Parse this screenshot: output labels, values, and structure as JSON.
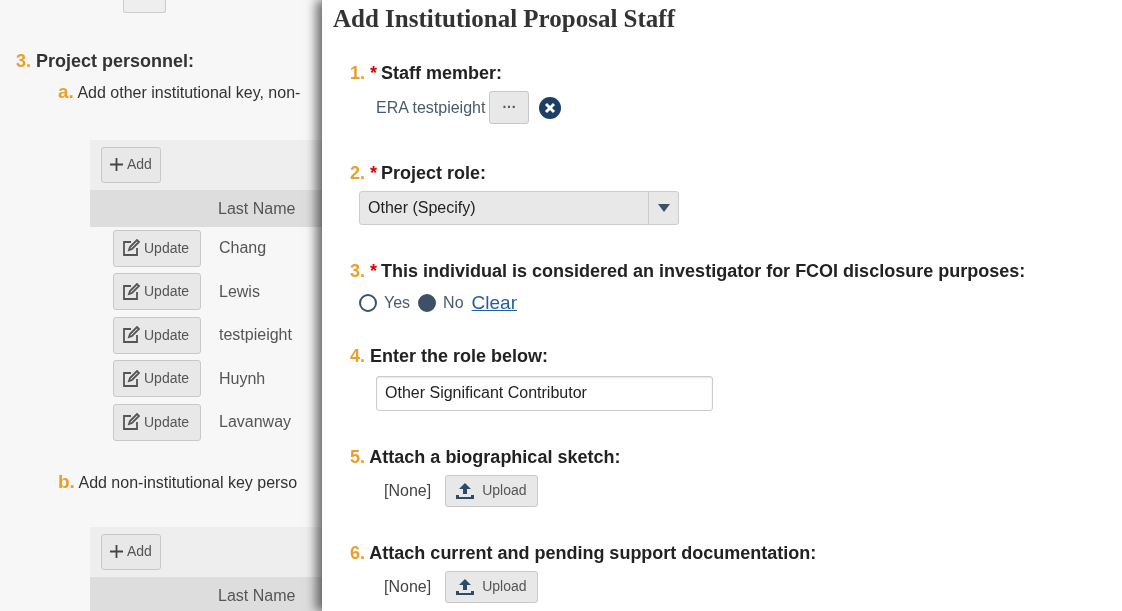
{
  "background": {
    "section": {
      "number": "3.",
      "title": "Project personnel:"
    },
    "subsections": [
      {
        "letter": "a.",
        "text": "Add other institutional key, non-",
        "add_label": "Add",
        "columns": [
          "Last Name"
        ],
        "rows": [
          {
            "button": "Update",
            "last_name": "Chang"
          },
          {
            "button": "Update",
            "last_name": "Lewis"
          },
          {
            "button": "Update",
            "last_name": "testpieight"
          },
          {
            "button": "Update",
            "last_name": "Huynh"
          },
          {
            "button": "Update",
            "last_name": "Lavanway"
          }
        ]
      },
      {
        "letter": "b.",
        "text": "Add non-institutional key perso",
        "add_label": "Add",
        "columns": [
          "Last Name"
        ]
      }
    ]
  },
  "panel": {
    "title": "Add Institutional Proposal Staff",
    "fields": [
      {
        "number": "1.",
        "required_mark": "*",
        "label": "Staff member:",
        "kind": "staff",
        "value": "ERA testpieight",
        "button": "···"
      },
      {
        "number": "2.",
        "required_mark": "*",
        "label": "Project role:",
        "kind": "select",
        "value": "Other (Specify)"
      },
      {
        "number": "3.",
        "required_mark": "*",
        "label": "This individual is considered an investigator for FCOI disclosure purposes:",
        "kind": "radio",
        "options": [
          {
            "label": "Yes",
            "selected": false
          },
          {
            "label": "No",
            "selected": true
          }
        ],
        "clear_label": "Clear"
      },
      {
        "number": "4.",
        "label": "Enter the role below:",
        "kind": "text",
        "value": "Other Significant Contributor"
      },
      {
        "number": "5.",
        "label": "Attach a biographical sketch:",
        "kind": "upload",
        "value": "[None]",
        "button": "Upload"
      },
      {
        "number": "6.",
        "label": "Attach current and pending support documentation:",
        "kind": "upload",
        "value": "[None]",
        "button": "Upload"
      }
    ]
  }
}
